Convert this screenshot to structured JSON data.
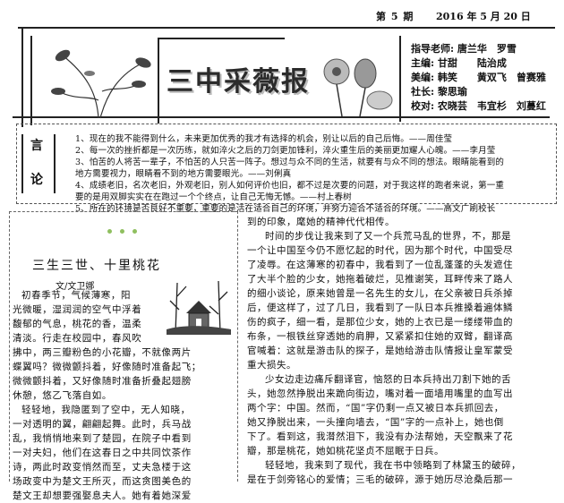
{
  "header": {
    "issue": "第 5 期",
    "date": "2016 年 5 月 20 日",
    "title": "三中采薇报"
  },
  "staff": [
    "指导老师: 唐兰华　罗雪",
    "主编: 甘甜　　陆治成",
    "美编: 韩笑　　黄双飞　曾赛雅",
    "社长: 黎思瑜",
    "校对: 农晓芸　韦宜杉　刘蔓红"
  ],
  "quotes": {
    "label_1": "言",
    "label_2": "论",
    "lines": [
      "1、现在的我不能得到什么，未来更加优秀的我才有选择的机会，别让以后的自己后悔。——周佳莹",
      "2、每一次的挫折都是一次历练，就如淬火之后的刀剑更加锋利，淬火重生后的美丽更加耀人心魄。——李月莹",
      "3、怕苦的人将苦一辈子，不怕苦的人只苦一阵子。想过与众不同的生活，就要有与众不同的想法。眼睛能看到的",
      "地方需要视力，眼睛看不到的地方需要眼光。——刘俐真",
      "4、成绩老旧，名次老旧，外观老旧，别人如何评价也旧，都不过是次要的问题，对于我这样的跑者来说，第一重",
      "要的是用双脚实实在在跑过一个个终点，让自己无悔无憾。——村上春树",
      "5、所在的环境是否良好不重要，重要的是活在适合自己的环境，并努力迎合不适合的环境。——高文广刷校长"
    ]
  },
  "article": {
    "title": "三生三世、十里桃花",
    "byline": "文/文卫娜",
    "left_lines": [
      "初春季节，气候薄寒，阳",
      "光微暖，湿润润的空气中浮着",
      "馥郁的气息，桃花的香，温柔",
      "清淡。行走在校园中，春风吹",
      "拂中，两三瓣粉色的小花瓣，不就像两片",
      "蝶翼吗？微微颤抖着，好像随时准备起飞；",
      "微微颤抖着，又好像随时准备折叠起翅膀",
      "休憩，悠乙飞落自如。",
      "轻轻地，我隐匿到了空中，无人知晓，",
      "一对透明的翼，翩翩起舞。此时，兵马战",
      "乱，我悄悄地来到了楚园，在院子中看到",
      "一对夫妇，他们在这春日之中共同饮茶作",
      "诗，两此时政变悄然而至，丈夫急楼于这",
      "场政变中为楚文王所灭，而这贪图美色的",
      "楚文王却想要强娶息夫人。她有着她深爱"
    ],
    "right_lines": [
      "到的印象，麾她的精神代代相传。",
      "时间的步伐让我来到了又一个兵荒马乱的世界，不，那是",
      "一个让中国至今仍不愿忆起的时代，因为那个时代，中国受尽",
      "了凌辱。在这薄寒的初春中，我看到了一位乱蓬蓬的头发遮住",
      "了大半个脸的少女，她拖着破烂，见推谢笑，耳畔传来了路人",
      "的细小谈论，原来她曾是一名先生的女儿，在父亲被日兵杀掉",
      "后，便这样了，过了几日，我看到了一队日本兵推搡着遍体鳞",
      "伤的疯子，细一看，是那位少女，她的上衣已是一缕缕带血的",
      "布条，一根铁丝穿透她的肩胛，又紧紧扣住她的双臂，翻译高",
      "官喊着：这就是游击队的探子，是她给游击队情报让皇军蒙受",
      "重大损失。",
      "少女边走边痛斥翻译官，恼怒的日本兵持出刀割下她的舌",
      "头，她忽然挣脱出来跪向街边，嘴对着一面墙用嘴里的血写出",
      "两个字：中国。然而，“国”字仍剩一点又被日本兵抓回去，",
      "她又挣脱出来，一头撞向墙去，“国”字的一点补上，她也倒",
      "下了。看到这，我潸然泪下，我没有办法帮她，天空飘来了花",
      "瓣，那是桃花，她如桃花坚贞不屈眠于日兵。",
      "轻轻地，我来到了现代，我在书中领略到了林黛玉的破碎，",
      "是在于剑旁铭心的爱情；三毛的破碎，源于她历尽沧桑后那一"
    ]
  }
}
